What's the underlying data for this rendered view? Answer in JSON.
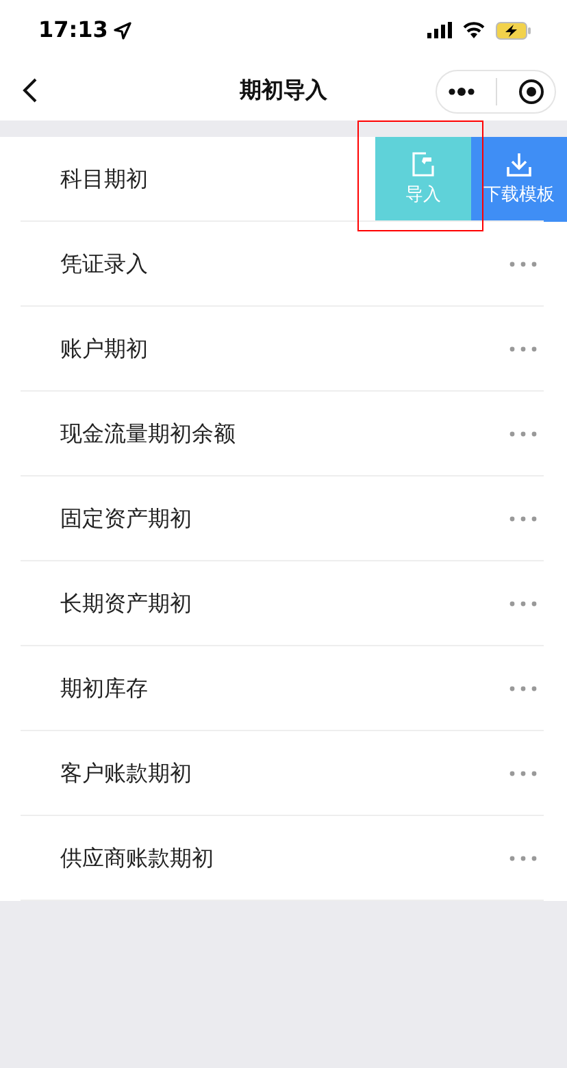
{
  "status_bar": {
    "time": "17:13"
  },
  "nav": {
    "title": "期初导入"
  },
  "rows": [
    {
      "label": "科目期初",
      "actions": [
        {
          "kind": "import",
          "label": "导入",
          "highlighted": true
        },
        {
          "kind": "download",
          "label": "下载模板",
          "highlighted": false
        }
      ]
    },
    {
      "label": "凭证录入"
    },
    {
      "label": "账户期初"
    },
    {
      "label": "现金流量期初余额"
    },
    {
      "label": "固定资产期初"
    },
    {
      "label": "长期资产期初"
    },
    {
      "label": "期初库存"
    },
    {
      "label": "客户账款期初"
    },
    {
      "label": "供应商账款期初"
    }
  ]
}
